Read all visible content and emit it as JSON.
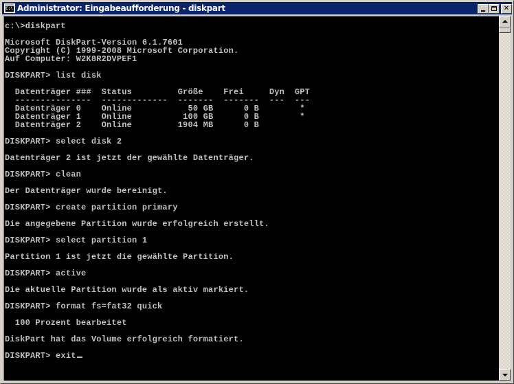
{
  "window": {
    "title": "Administrator: Eingabeaufforderung - diskpart",
    "icon": "cmd-icon",
    "icon_text": "C:\\",
    "buttons": {
      "minimize": "minimize-icon",
      "maximize": "maximize-icon",
      "close": "✕"
    }
  },
  "console": {
    "lines": [
      "c:\\>diskpart",
      "",
      "Microsoft DiskPart-Version 6.1.7601",
      "Copyright (C) 1999-2008 Microsoft Corporation.",
      "Auf Computer: W2K8R2DVPEF1",
      "",
      "DISKPART> list disk",
      "",
      "  Datenträger ###  Status         Größe    Frei     Dyn  GPT",
      "  ---------------  -------------  -------  -------  ---  ---",
      "  Datenträger 0    Online           50 GB      0 B        *",
      "  Datenträger 1    Online          100 GB      0 B        *",
      "  Datenträger 2    Online         1904 MB      0 B",
      "",
      "DISKPART> select disk 2",
      "",
      "Datenträger 2 ist jetzt der gewählte Datenträger.",
      "",
      "DISKPART> clean",
      "",
      "Der Datenträger wurde bereinigt.",
      "",
      "DISKPART> create partition primary",
      "",
      "Die angegebene Partition wurde erfolgreich erstellt.",
      "",
      "DISKPART> select partition 1",
      "",
      "Partition 1 ist jetzt die gewählte Partition.",
      "",
      "DISKPART> active",
      "",
      "Die aktuelle Partition wurde als aktiv markiert.",
      "",
      "DISKPART> format fs=fat32 quick",
      "",
      "  100 Prozent bearbeitet",
      "",
      "DiskPart hat das Volume erfolgreich formatiert.",
      "",
      "DISKPART> exit"
    ],
    "text_color": "#c0c0c0",
    "background": "#000000"
  },
  "colors": {
    "titlebar": "#0a246a",
    "chrome": "#d4d0c8"
  }
}
